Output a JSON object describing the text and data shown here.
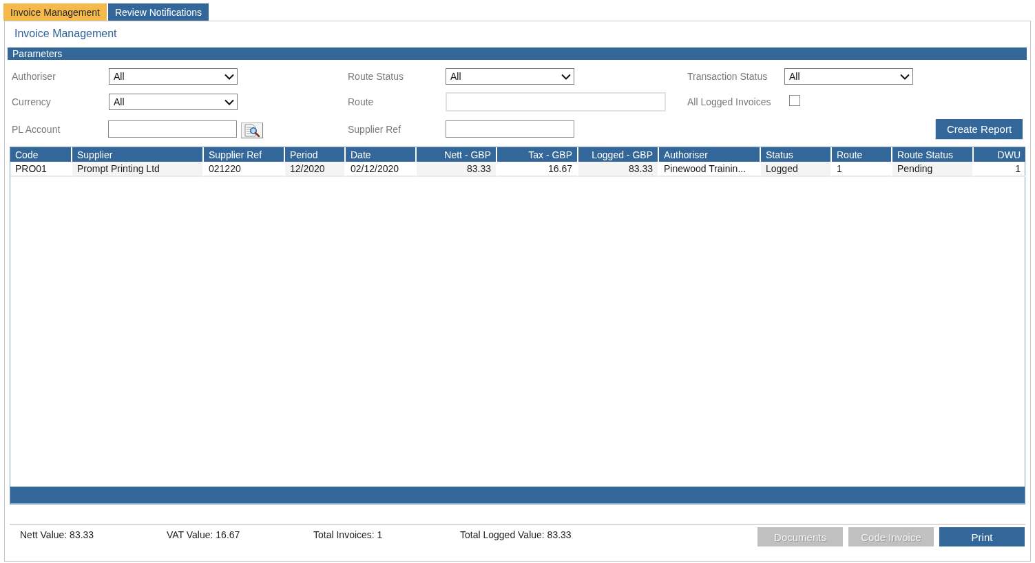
{
  "tabs": [
    {
      "label": "Invoice Management",
      "selected": true
    },
    {
      "label": "Review Notifications",
      "selected": false
    }
  ],
  "page_title": "Invoice Management",
  "parameters": {
    "title": "Parameters",
    "rows": [
      [
        {
          "label": "Authoriser",
          "kind": "select",
          "value": "All"
        },
        {
          "label": "Route Status",
          "kind": "select",
          "value": "All"
        },
        {
          "label": "Transaction Status",
          "kind": "select",
          "value": "All"
        }
      ],
      [
        {
          "label": "Currency",
          "kind": "select",
          "value": "All"
        },
        {
          "label": "Route",
          "kind": "textarea"
        },
        {
          "label": "All Logged Invoices",
          "kind": "checkbox",
          "checked": false
        }
      ],
      [
        {
          "label": "PL Account",
          "kind": "lookup"
        },
        {
          "label": "Supplier Ref",
          "kind": "text"
        },
        {
          "label": "Create Report",
          "kind": "button"
        }
      ]
    ]
  },
  "table": {
    "columns": [
      {
        "label": "Code",
        "kind": "text"
      },
      {
        "label": "Supplier",
        "kind": "text"
      },
      {
        "label": "Supplier Ref",
        "kind": "text"
      },
      {
        "label": "Period",
        "kind": "text"
      },
      {
        "label": "Date",
        "kind": "text"
      },
      {
        "label": "Nett - GBP",
        "kind": "numeric"
      },
      {
        "label": "Tax - GBP",
        "kind": "numeric"
      },
      {
        "label": "Logged - GBP",
        "kind": "numeric"
      },
      {
        "label": "Authoriser",
        "kind": "text"
      },
      {
        "label": "Status",
        "kind": "text"
      },
      {
        "label": "Route",
        "kind": "text"
      },
      {
        "label": "Route Status",
        "kind": "text"
      },
      {
        "label": "DWU",
        "kind": "numeric"
      }
    ],
    "rows": [
      [
        "PRO01",
        "Prompt Printing Ltd",
        "021220",
        "12/2020",
        "02/12/2020",
        "83.33",
        "16.67",
        "83.33",
        "Pinewood Trainin...",
        "Logged",
        "1",
        "Pending",
        "1"
      ]
    ]
  },
  "totals": [
    "Nett Value: 83.33",
    "VAT Value: 16.67",
    "Total Invoices: 1",
    "Total Logged Value: 83.33"
  ],
  "footer_buttons": [
    {
      "label": "Documents",
      "disabled": true
    },
    {
      "label": "Code Invoice",
      "disabled": true
    },
    {
      "label": "Print",
      "disabled": false
    }
  ]
}
